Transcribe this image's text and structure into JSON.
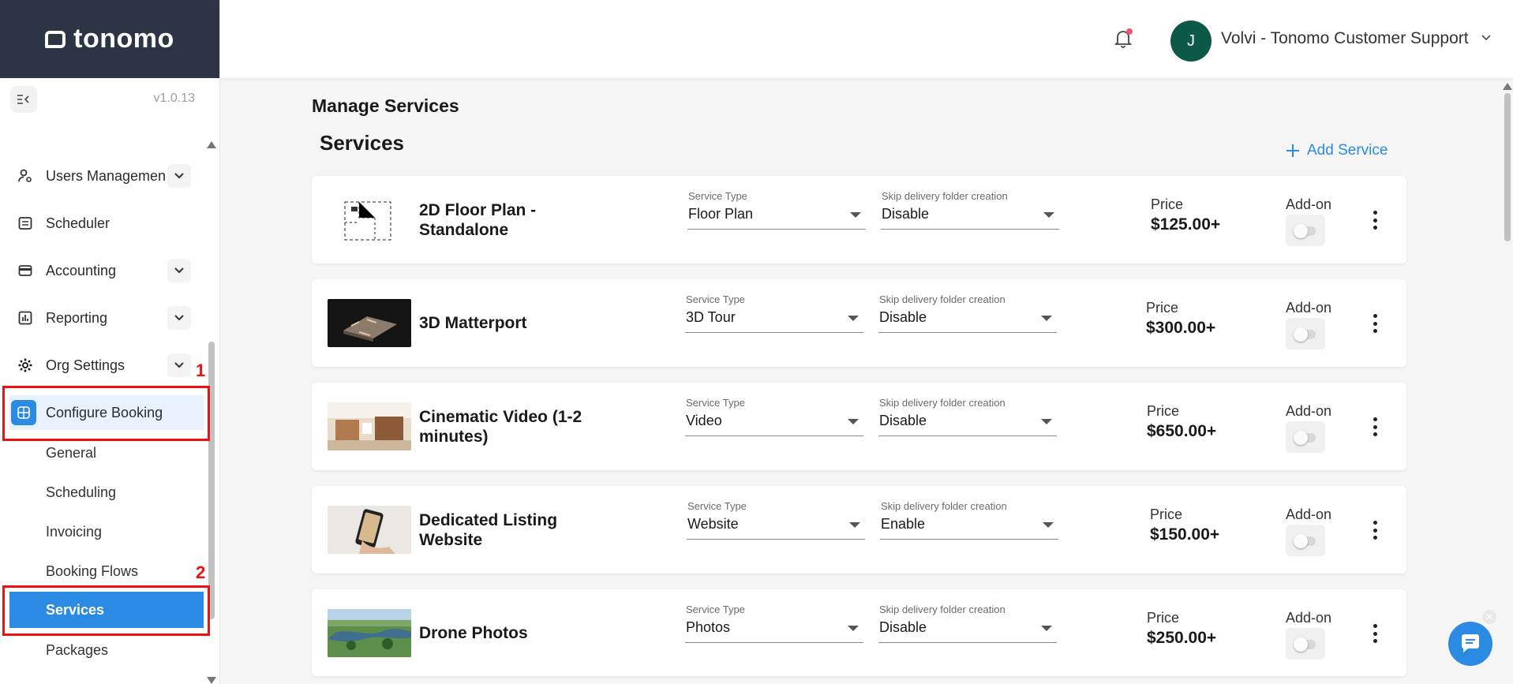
{
  "app": {
    "logo_text": "tonomo",
    "version": "v1.0.13"
  },
  "header": {
    "avatar_initial": "J",
    "user_name": "Volvi - Tonomo Customer Support"
  },
  "sidebar": {
    "items": [
      {
        "label": "Users Managemen",
        "icon": "users-icon"
      },
      {
        "label": "Scheduler",
        "icon": "calendar-icon"
      },
      {
        "label": "Accounting",
        "icon": "wallet-icon"
      },
      {
        "label": "Reporting",
        "icon": "chart-icon"
      },
      {
        "label": "Org Settings",
        "icon": "gear-icon"
      },
      {
        "label": "Configure Booking",
        "icon": "booking-icon"
      }
    ],
    "sub_items": [
      "General",
      "Scheduling",
      "Invoicing",
      "Booking Flows",
      "Services",
      "Packages"
    ],
    "annotations": [
      "1",
      "2"
    ]
  },
  "main": {
    "page_title": "Manage Services",
    "section_title": "Services",
    "add_service_label": "Add Service",
    "field_labels": {
      "service_type": "Service Type",
      "skip_delivery": "Skip delivery folder creation"
    },
    "price_label": "Price",
    "addon_label": "Add-on",
    "services": [
      {
        "name": "2D Floor Plan - Standalone",
        "service_type": "Floor Plan",
        "skip_delivery": "Disable",
        "price": "$125.00+",
        "addon": false
      },
      {
        "name": "3D Matterport",
        "service_type": "3D Tour",
        "skip_delivery": "Disable",
        "price": "$300.00+",
        "addon": false
      },
      {
        "name": "Cinematic Video (1-2 minutes)",
        "service_type": "Video",
        "skip_delivery": "Disable",
        "price": "$650.00+",
        "addon": false
      },
      {
        "name": "Dedicated Listing Website",
        "service_type": "Website",
        "skip_delivery": "Enable",
        "price": "$150.00+",
        "addon": false
      },
      {
        "name": "Drone Photos",
        "service_type": "Photos",
        "skip_delivery": "Disable",
        "price": "$250.00+",
        "addon": false
      }
    ]
  },
  "colors": {
    "accent": "#2b8ae2",
    "sidebar_header": "#2d3446",
    "annotation_red": "#e11111",
    "avatar": "#0b5946"
  }
}
